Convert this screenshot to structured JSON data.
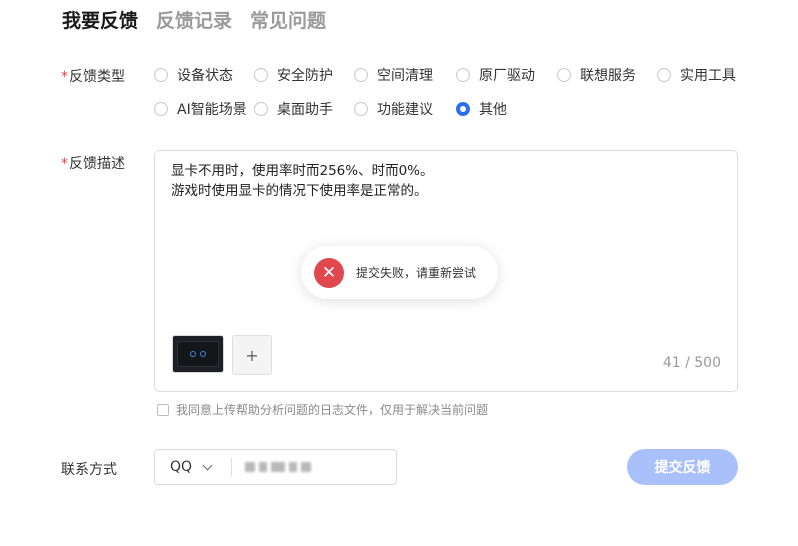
{
  "tabs": [
    {
      "label": "我要反馈",
      "active": true
    },
    {
      "label": "反馈记录",
      "active": false
    },
    {
      "label": "常见问题",
      "active": false
    }
  ],
  "form": {
    "required_mark": "*",
    "type_label": "反馈类型",
    "type_options": [
      "设备状态",
      "安全防护",
      "空间清理",
      "原厂驱动",
      "联想服务",
      "实用工具",
      "AI智能场景",
      "桌面助手",
      "功能建议",
      "其他"
    ],
    "type_selected": "其他",
    "desc_label": "反馈描述",
    "desc_value": "显卡不用时，使用率时而256%、时而0%。\n游戏时使用显卡的情况下使用率是正常的。",
    "desc_counter": "41 / 500",
    "add_attachment": "+",
    "agree_text": "我同意上传帮助分析问题的日志文件，仅用于解决当前问题",
    "contact_label": "联系方式",
    "contact_type": "QQ",
    "submit_label": "提交反馈"
  },
  "toast": {
    "message": "提交失败，请重新尝试",
    "icon": "error-x-icon"
  },
  "colors": {
    "accent": "#2b6ff0",
    "required": "#e8433c",
    "error": "#e0474f",
    "submit_disabled": "#a9c0fb"
  }
}
